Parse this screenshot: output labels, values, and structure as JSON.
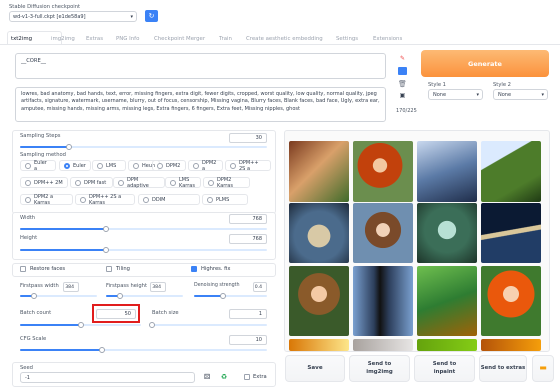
{
  "checkpoint": {
    "label": "Stable Diffusion checkpoint",
    "value": "wd-v1-3-full.ckpt [e1de58a9]"
  },
  "tabs": [
    "txt2img",
    "img2img",
    "Extras",
    "PNG Info",
    "Checkpoint Merger",
    "Train",
    "Create aesthetic embedding",
    "Settings",
    "Extensions"
  ],
  "prompt": "__CORE__",
  "negative_prompt": "lowres, bad anatomy, bad hands, text, error, missing fingers, extra digit, fewer digits, cropped, worst quality, low quality, normal quality, jpeg artifacts, signature, watermark, username, blurry, out of focus, censorship, Missing vagina, Blurry faces, Blank faces, bad face, Ugly, extra ear, amputee, missing hands, missing arms, missing legs, Extra fingers, 6 fingers, Extra feet, Missing nipples, ghost",
  "token_count": "170/225",
  "generate_label": "Generate",
  "style1": {
    "label": "Style 1",
    "value": "None"
  },
  "style2": {
    "label": "Style 2",
    "value": "None"
  },
  "sampling_steps": {
    "label": "Sampling Steps",
    "value": "30",
    "fraction": 0.2
  },
  "sampling_method": {
    "label": "Sampling method",
    "options": [
      "Euler a",
      "Euler",
      "LMS",
      "Heun",
      "DPM2",
      "DPM2 a",
      "DPM++ 2S a",
      "DPM++ 2M",
      "DPM fast",
      "DPM adaptive",
      "LMS Karras",
      "DPM2 Karras",
      "DPM2 a Karras",
      "DPM++ 2S a Karras",
      "DDIM",
      "PLMS"
    ],
    "selected": "Euler"
  },
  "width": {
    "label": "Width",
    "value": "768",
    "fraction": 0.35
  },
  "height": {
    "label": "Height",
    "value": "768",
    "fraction": 0.35
  },
  "restore_faces": {
    "label": "Restore faces",
    "checked": false
  },
  "tiling": {
    "label": "Tiling",
    "checked": false
  },
  "highres_fix": {
    "label": "Highres. fix",
    "checked": true
  },
  "firstpass_width": {
    "label": "Firstpass width",
    "value": "384",
    "fraction": 0.18
  },
  "firstpass_height": {
    "label": "Firstpass height",
    "value": "384",
    "fraction": 0.18
  },
  "denoising_strength": {
    "label": "Denoising strength",
    "value": "0.4",
    "fraction": 0.4
  },
  "batch_count": {
    "label": "Batch count",
    "value": "50",
    "fraction": 0.5
  },
  "batch_size": {
    "label": "Batch size",
    "value": "1",
    "fraction": 0.0
  },
  "cfg_scale": {
    "label": "CFG Scale",
    "value": "10",
    "fraction": 0.33
  },
  "seed": {
    "label": "Seed",
    "value": "-1"
  },
  "extra": {
    "label": "Extra"
  },
  "output_buttons": {
    "save": "Save",
    "img2img": "Send to img2img",
    "inpaint": "Send to inpaint",
    "extras": "Send to extras"
  },
  "colors": {
    "accent": "#3b82f6",
    "generate": "#fb923c",
    "highlight_box": "#e11d1d"
  },
  "icons": [
    "refresh-icon",
    "paint-icon",
    "trash-icon",
    "save-icon",
    "clipboard-icon",
    "dice-icon",
    "recycle-icon",
    "folder-icon"
  ]
}
